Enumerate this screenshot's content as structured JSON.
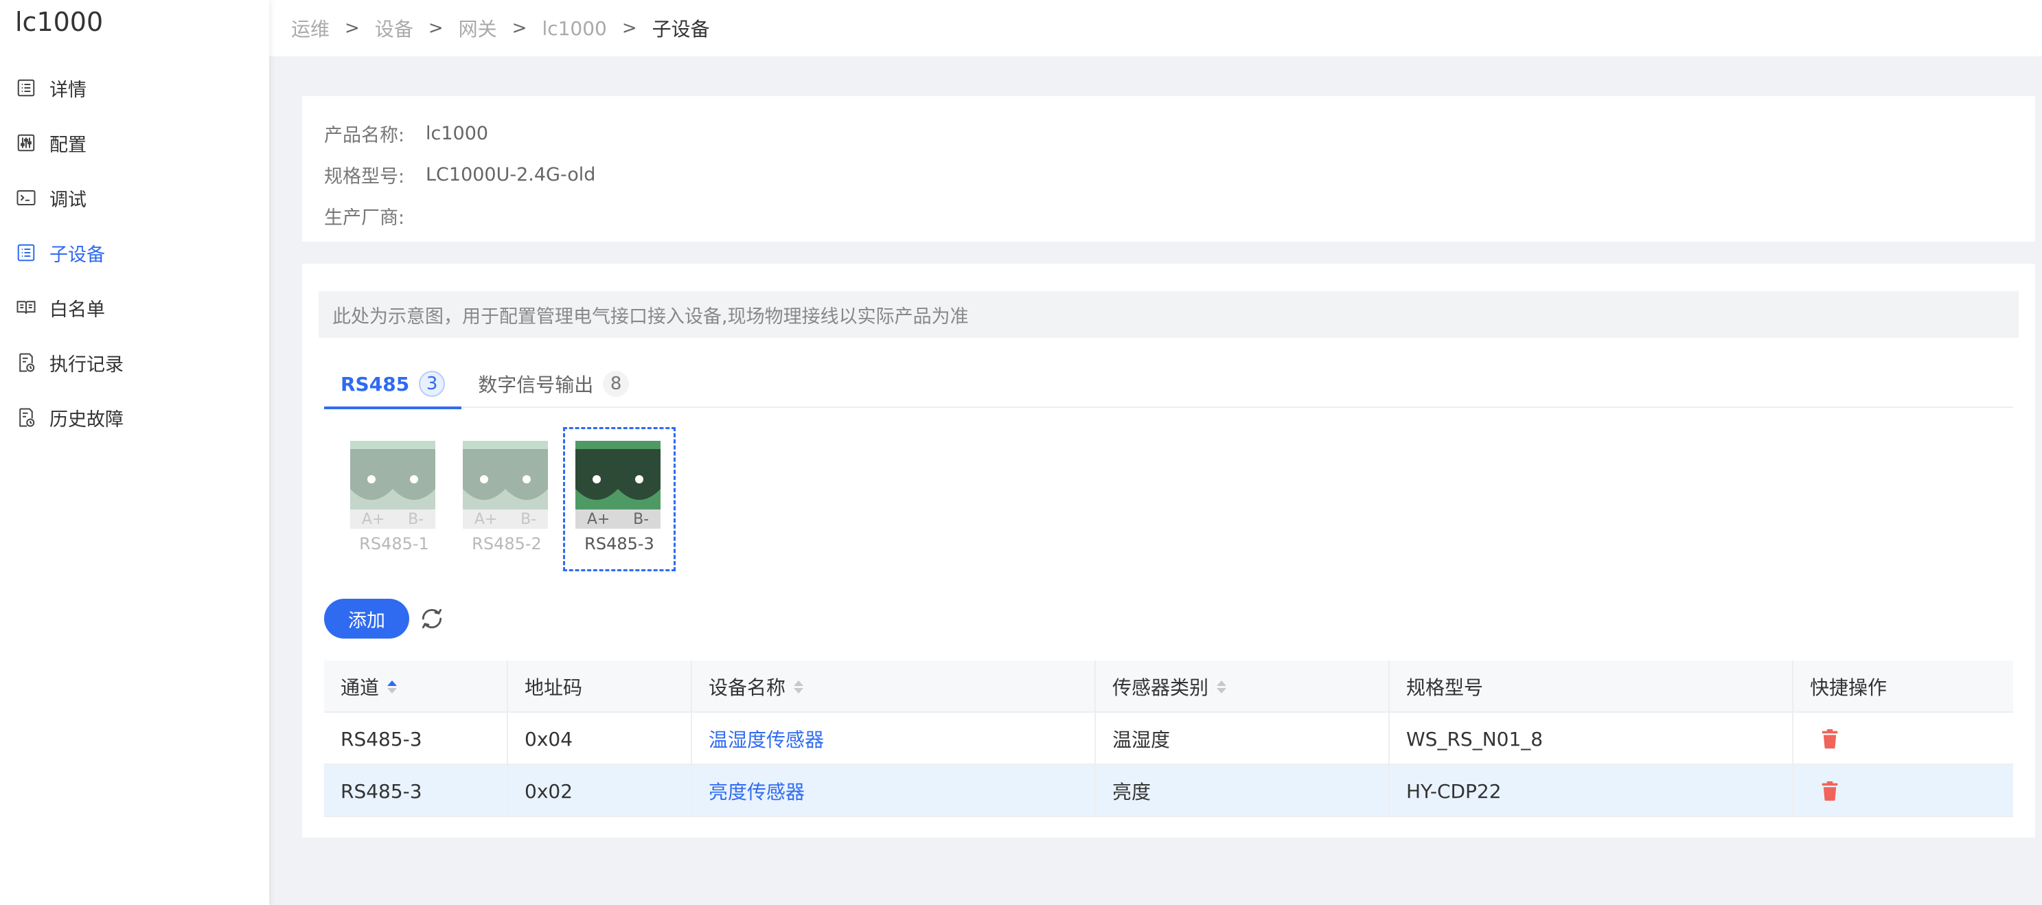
{
  "app": {
    "title": "lc1000"
  },
  "sidebar": {
    "items": [
      {
        "label": "详情",
        "icon": "list-icon",
        "active": false
      },
      {
        "label": "配置",
        "icon": "sliders-icon",
        "active": false
      },
      {
        "label": "调试",
        "icon": "terminal-icon",
        "active": false
      },
      {
        "label": "子设备",
        "icon": "list-icon",
        "active": true
      },
      {
        "label": "白名单",
        "icon": "book-icon",
        "active": false
      },
      {
        "label": "执行记录",
        "icon": "history-doc-icon",
        "active": false
      },
      {
        "label": "历史故障",
        "icon": "history-doc-icon",
        "active": false
      }
    ]
  },
  "breadcrumb": [
    "运维",
    "设备",
    "网关",
    "lc1000",
    "子设备"
  ],
  "product": {
    "name_label": "产品名称:",
    "name_value": "lc1000",
    "model_label": "规格型号:",
    "model_value": "LC1000U-2.4G-old",
    "maker_label": "生产厂商:",
    "maker_value": ""
  },
  "notice": "此处为示意图，用于配置管理电气接口接入设备,现场物理接线以实际产品为准",
  "tabs": [
    {
      "label": "RS485",
      "count": "3",
      "active": true
    },
    {
      "label": "数字信号输出",
      "count": "8",
      "active": false
    }
  ],
  "ports": [
    {
      "name": "RS485-1",
      "pin_a": "A+",
      "pin_b": "B-",
      "selected": false
    },
    {
      "name": "RS485-2",
      "pin_a": "A+",
      "pin_b": "B-",
      "selected": false
    },
    {
      "name": "RS485-3",
      "pin_a": "A+",
      "pin_b": "B-",
      "selected": true
    }
  ],
  "actions": {
    "add_label": "添加"
  },
  "table": {
    "headers": [
      "通道",
      "地址码",
      "设备名称",
      "传感器类别",
      "规格型号",
      "快捷操作"
    ],
    "rows": [
      {
        "channel": "RS485-3",
        "address": "0x04",
        "device": "温湿度传感器",
        "category": "温湿度",
        "model": "WS_RS_N01_8"
      },
      {
        "channel": "RS485-3",
        "address": "0x02",
        "device": "亮度传感器",
        "category": "亮度",
        "model": "HY-CDP22"
      }
    ]
  },
  "colors": {
    "accent": "#2f6bf0",
    "delete": "#f0645a",
    "port_idle": "#9fb3a6",
    "port_selected": "#2d4a37"
  }
}
